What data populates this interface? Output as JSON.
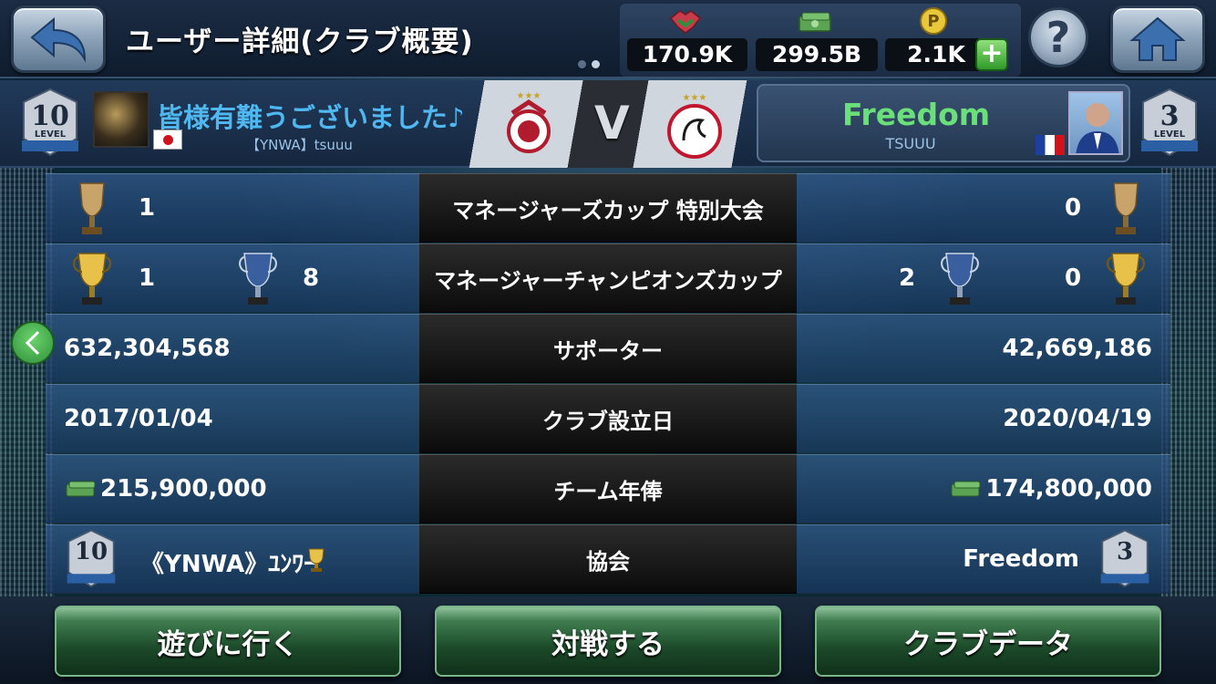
{
  "header": {
    "title": "ユーザー詳細(クラブ概要)",
    "currency": {
      "gp": "170.9K",
      "money": "299.5B",
      "coins": "2.1K"
    }
  },
  "match": {
    "left": {
      "club_name": "皆様有難うございました♪",
      "user_name": "【YNWA】tsuuu",
      "level": "10",
      "level_label": "LEVEL"
    },
    "vs_label": "V",
    "right": {
      "club_name": "Freedom",
      "user_name": "TSUUU",
      "level": "3",
      "level_label": "LEVEL"
    }
  },
  "rows": {
    "managers_cup": {
      "label": "マネージャーズカップ 特別大会",
      "left": "1",
      "right": "0"
    },
    "champions_cup": {
      "label": "マネージャーチャンピオンズカップ",
      "left_gold": "1",
      "left_silver": "8",
      "right_silver": "2",
      "right_gold": "0"
    },
    "supporters": {
      "label": "サポーター",
      "left": "632,304,568",
      "right": "42,669,186"
    },
    "founded": {
      "label": "クラブ設立日",
      "left": "2017/01/04",
      "right": "2020/04/19"
    },
    "salary": {
      "label": "チーム年俸",
      "left": "215,900,000",
      "right": "174,800,000"
    },
    "association": {
      "label": "協会",
      "left": "《YNWA》ﾕﾝﾜｰ",
      "right": "Freedom",
      "left_level": "10",
      "right_level": "3"
    }
  },
  "buttons": {
    "visit": "遊びに行く",
    "match": "対戦する",
    "club_data": "クラブデータ"
  },
  "colors": {
    "accent_green": "#6be07a",
    "club_blue": "#4fb8f0"
  }
}
